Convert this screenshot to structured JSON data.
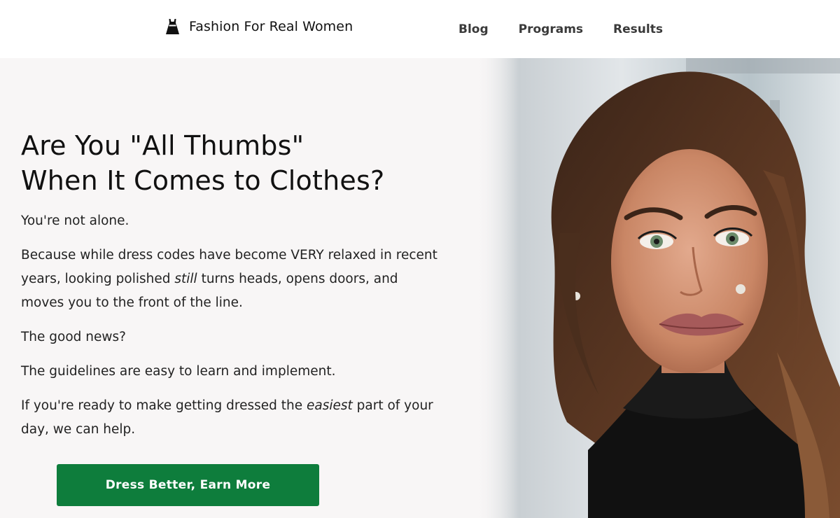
{
  "header": {
    "brand_icon": "dress-icon",
    "brand_name": "Fashion For Real Women",
    "nav": [
      {
        "label": "Blog"
      },
      {
        "label": "Programs"
      },
      {
        "label": "Results"
      }
    ]
  },
  "hero": {
    "headline_line1": "Are You \"All Thumbs\"",
    "headline_line2": "When It Comes to Clothes?",
    "p1": "You're not alone.",
    "p2_part1": "Because while dress codes have become VERY relaxed in recent years, looking polished ",
    "p2_emphasis": "still",
    "p2_part2": " turns heads, opens doors, and moves you to the front of the line.",
    "p3": "The good news?",
    "p4": "The guidelines are easy to learn and implement.",
    "p5_part1": "If you're ready to make getting dressed the ",
    "p5_emphasis": "easiest",
    "p5_part2": " part of your day, we can help.",
    "cta_label": "Dress Better, Earn More",
    "photo_icon": "woman-portrait-photo"
  },
  "colors": {
    "cta_green": "#0e7d3c",
    "hero_bg": "#f8f6f6",
    "header_bg": "#ffffff"
  }
}
